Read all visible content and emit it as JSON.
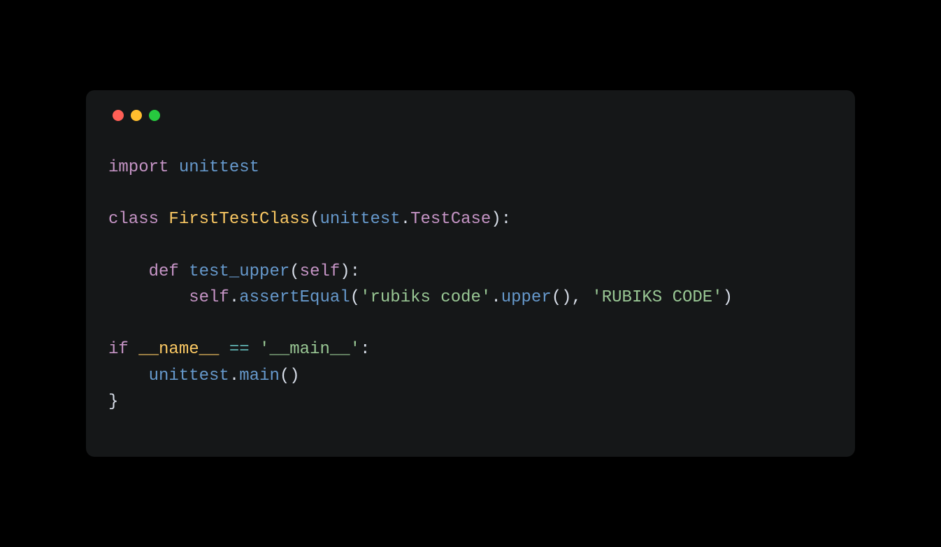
{
  "code": {
    "line1": {
      "kw_import": "import",
      "module": "unittest"
    },
    "line3": {
      "kw_class": "class",
      "classname": "FirstTestClass",
      "lparen": "(",
      "base_mod": "unittest",
      "dot": ".",
      "base_cls": "TestCase",
      "rparen_colon": "):"
    },
    "line5": {
      "indent": "    ",
      "kw_def": "def",
      "funcname": "test_upper",
      "lparen": "(",
      "selfkw": "self",
      "rparen_colon": "):"
    },
    "line6": {
      "indent": "        ",
      "selfkw": "self",
      "dot1": ".",
      "assert_fn": "assertEqual",
      "lparen": "(",
      "str1": "'rubiks code'",
      "dot2": ".",
      "upper_fn": "upper",
      "call": "(), ",
      "str2": "'RUBIKS CODE'",
      "rparen": ")"
    },
    "line8": {
      "kw_if": "if",
      "dunder_name": "__name__",
      "op_eq": " == ",
      "str_main": "'__main__'",
      "colon": ":"
    },
    "line9": {
      "indent": "    ",
      "module": "unittest",
      "dot": ".",
      "main_fn": "main",
      "call": "()"
    },
    "line10": {
      "brace": "}"
    }
  }
}
